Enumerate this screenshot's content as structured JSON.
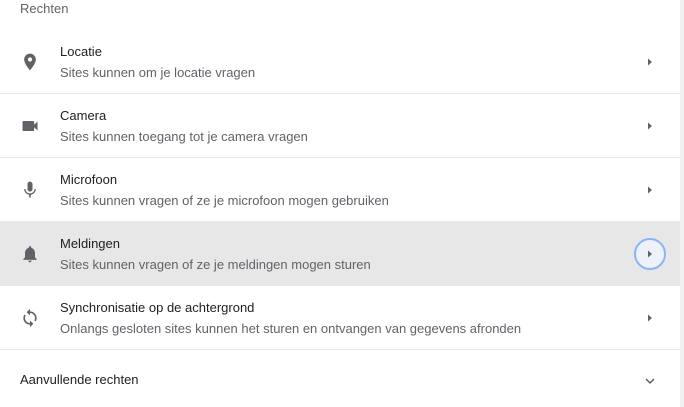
{
  "section": {
    "title": "Rechten"
  },
  "permissions": [
    {
      "title": "Locatie",
      "description": "Sites kunnen om je locatie vragen",
      "icon": "location-pin-icon"
    },
    {
      "title": "Camera",
      "description": "Sites kunnen toegang tot je camera vragen",
      "icon": "camera-icon"
    },
    {
      "title": "Microfoon",
      "description": "Sites kunnen vragen of ze je microfoon mogen gebruiken",
      "icon": "microphone-icon"
    },
    {
      "title": "Meldingen",
      "description": "Sites kunnen vragen of ze je meldingen mogen sturen",
      "icon": "bell-icon"
    },
    {
      "title": "Synchronisatie op de achtergrond",
      "description": "Onlangs gesloten sites kunnen het sturen en ontvangen van gegevens afronden",
      "icon": "sync-icon"
    }
  ],
  "additional": {
    "label": "Aanvullende rechten",
    "icon": "chevron-down-icon"
  },
  "colors": {
    "highlight_row": "#e7e7e7",
    "focus_ring": "#8ab4f8",
    "icon": "#5f6368"
  }
}
